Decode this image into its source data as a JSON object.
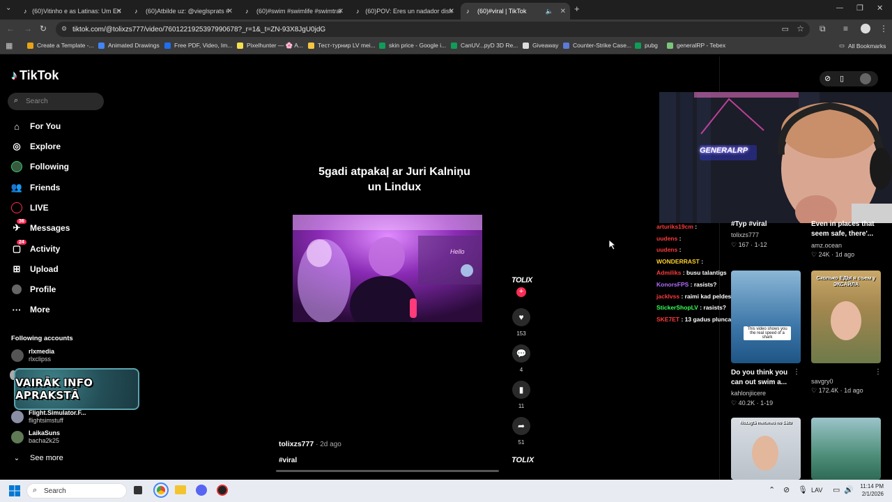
{
  "browser": {
    "tabs": [
      {
        "label": "(60)Vitinho e as Latinas: Um En",
        "active": false
      },
      {
        "label": "(60)Atbilde uz: @vieglsprats #",
        "active": false
      },
      {
        "label": "(60)#swim #swimlife #swimtrai",
        "active": false
      },
      {
        "label": "(60)POV: Eres un nadador disfr",
        "active": false
      },
      {
        "label": "(60)#viral | TikTok",
        "active": true
      }
    ],
    "url": "tiktok.com/@tolixzs777/video/7601221925397990678?_r=1&_t=ZN-93X8JgU0jdG",
    "bookmarks": [
      {
        "label": "Create a Template -...",
        "color": "#e8a317"
      },
      {
        "label": "Animated Drawings",
        "color": "#4285f4"
      },
      {
        "label": "Free PDF, Video, Im...",
        "color": "#1e6ff1"
      },
      {
        "label": "Pixelhunter — 🌸 A...",
        "color": "#f4e04d"
      },
      {
        "label": "Тест-турнир LV mei...",
        "color": "#f5c542"
      },
      {
        "label": "skin price - Google i...",
        "color": "#0f9d58"
      },
      {
        "label": "CanUV...pyD 3D Re...",
        "color": "#0f9d58"
      },
      {
        "label": "Giveaway",
        "color": "#ddd"
      },
      {
        "label": "Counter-Strike Case...",
        "color": "#5b7bd6"
      },
      {
        "label": "pubg",
        "color": "#0f9d58"
      },
      {
        "label": "generalRP - Tebex",
        "color": "#7bc67b"
      }
    ],
    "all_bookmarks": "All Bookmarks"
  },
  "sidebar": {
    "logo": "TikTok",
    "search_placeholder": "Search",
    "nav": [
      {
        "label": "For You",
        "icon": "home-icon"
      },
      {
        "label": "Explore",
        "icon": "compass-icon"
      },
      {
        "label": "Following",
        "icon": "following-avatar-icon"
      },
      {
        "label": "Friends",
        "icon": "friends-icon"
      },
      {
        "label": "LIVE",
        "icon": "live-icon"
      },
      {
        "label": "Messages",
        "icon": "messages-icon",
        "badge": "36"
      },
      {
        "label": "Activity",
        "icon": "activity-icon",
        "badge": "24"
      },
      {
        "label": "Upload",
        "icon": "upload-icon"
      },
      {
        "label": "Profile",
        "icon": "profile-avatar-icon"
      },
      {
        "label": "More",
        "icon": "more-icon"
      }
    ],
    "following_header": "Following accounts",
    "accounts": [
      {
        "name": "rlxmedia",
        "handle": "rlxclipss"
      },
      {
        "name": "Flight.Simulator.F...",
        "handle": "flightsimstuff"
      },
      {
        "name": "LaikaSuns",
        "handle": "bacha2k25"
      }
    ],
    "see_more": "See more",
    "overlay_banner": "VAIRĀK INFO APRAKSTĀ"
  },
  "video": {
    "title_line1": "5gadi atpakaļ ar Juri Kalniņu",
    "title_line2": "un Lindux",
    "in_video_sign": "Hello",
    "author": "tolixzs777",
    "age": "· 2d ago",
    "caption": "#viral",
    "creator_badge": "TOLIX",
    "likes": "153",
    "comments": "4",
    "saves": "11",
    "shares": "51"
  },
  "stream_overlay": {
    "neon_sign": "GENERALRP",
    "chat": [
      {
        "user": "arturiks19cm",
        "color": "#ff3b3b",
        "msg": ""
      },
      {
        "user": "uudens",
        "color": "#ff3b3b",
        "msg": ""
      },
      {
        "user": "uudens",
        "color": "#ff3b3b",
        "msg": ""
      },
      {
        "user": "WONDERRAST",
        "color": "#ffd12a",
        "msg": ""
      },
      {
        "user": "Admiliks",
        "color": "#ff3b3b",
        "msg": "busu talantigs"
      },
      {
        "user": "KonorsFPS",
        "color": "#b56cff",
        "msg": "rasists?"
      },
      {
        "user": "jacklvss",
        "color": "#ff3b3b",
        "msg": "raimi kad peldesanas strims"
      },
      {
        "user": "StickerShopLV",
        "color": "#39ff5a",
        "msg": "rasists?"
      },
      {
        "user": "SKE7ET",
        "color": "#ff3b3b",
        "msg": "13 gadus pluncajas"
      }
    ]
  },
  "recommendations": [
    {
      "title": "#Typ #viral",
      "user": "tolixzs777",
      "stats": "♡ 167 · 1-12"
    },
    {
      "title": "Even in places that seem safe, there'...",
      "user": "amz.ocean",
      "stats": "♡ 24K · 1d ago"
    },
    {
      "title": "Do you think you can out swim a...",
      "user": "kahlonjiicere",
      "stats": "♡ 40.2K · 1-19",
      "thumb_text": "This video shows you the real speed of a shark"
    },
    {
      "title": "",
      "user": "savgry0",
      "stats": "♡ 172.4K · 1d ago",
      "thumb_text": "Сколько ЕДЫ я съем у ЭКСАЙЛА"
    },
    {
      "title": "",
      "user": "",
      "stats": "",
      "thumb_text": "Nozagtā meitenes no Sātu"
    },
    {
      "title": "",
      "user": "",
      "stats": "",
      "thumb_text": ""
    }
  ],
  "taskbar": {
    "search_placeholder": "Search",
    "lang": "LAV",
    "time": "11:14 PM",
    "date": "2/1/2026"
  }
}
